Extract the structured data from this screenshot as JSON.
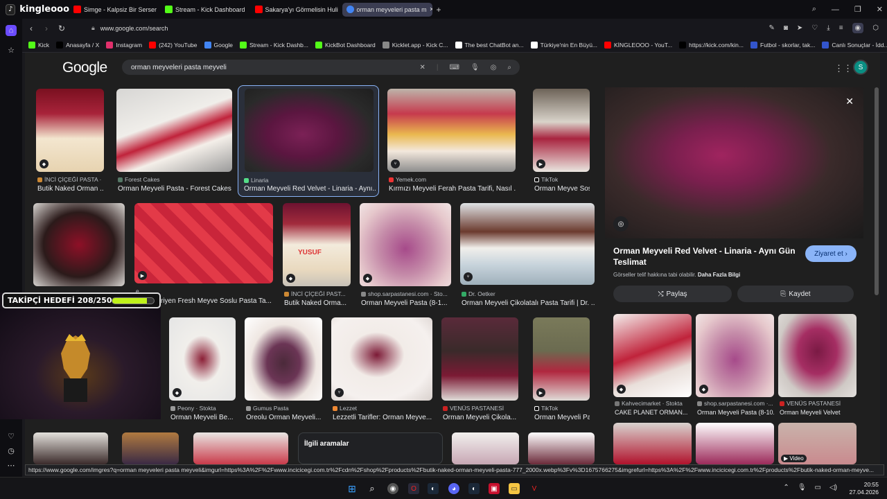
{
  "browser": {
    "brand": "kingleooo",
    "tabs": [
      {
        "label": "Simge - Kalpsiz Bir Serser",
        "color": "#ff0000"
      },
      {
        "label": "Stream - Kick Dashboard",
        "color": "#53fc18"
      },
      {
        "label": "Sakarya'yı Görmelisin Huli",
        "color": "#ff0000"
      },
      {
        "label": "orman meyveleri pasta m",
        "color": "#4285f4",
        "active": true
      }
    ],
    "url": "www.google.com/search",
    "bookmarks": [
      {
        "label": "Kick",
        "color": "#53fc18"
      },
      {
        "label": "Anasayfa / X",
        "color": "#000000"
      },
      {
        "label": "Instagram",
        "color": "#e1306c"
      },
      {
        "label": "(242) YouTube",
        "color": "#ff0000"
      },
      {
        "label": "Google",
        "color": "#4285f4"
      },
      {
        "label": "Stream - Kick Dashb...",
        "color": "#53fc18"
      },
      {
        "label": "KickBot Dashboard",
        "color": "#53fc18"
      },
      {
        "label": "Kicklet.app - Kick C...",
        "color": "#888888"
      },
      {
        "label": "The best ChatBot an...",
        "color": "#ffffff"
      },
      {
        "label": "Türkiye'nin En Büyü...",
        "color": "#ffffff"
      },
      {
        "label": "KİNGLEOOO - YouT...",
        "color": "#ff0000"
      },
      {
        "label": "https://kick.com/kin...",
        "color": "#000000"
      },
      {
        "label": "Futbol - skorlar, tak...",
        "color": "#3355cc"
      },
      {
        "label": "Canlı Sonuçlar - İdd...",
        "color": "#3355cc"
      }
    ],
    "status_url": "https://www.google.com/imgres?q=orman meyveleri pasta meyveli&imgurl=https%3A%2F%2Fwww.incicicegi.com.tr%2Fcdn%2Fshop%2Fproducts%2Fbutik-naked-orman-meyveli-pasta-777_2000x.webp%3Fv%3D1675766275&imgrefurl=https%3A%2F%2Fwww.incicicegi.com.tr%2Fproducts%2Fbutik-naked-orman-meyve..."
  },
  "google": {
    "logo": "Google",
    "query": "orman meyveleri pasta meyveli",
    "avatar_letter": "S"
  },
  "results": {
    "row1": [
      {
        "source": "İNCİ ÇİÇEĞİ PASTA ·",
        "title": "Butik Naked Orman ..."
      },
      {
        "source": "Forest Cakes",
        "title": "Orman Meyveli Pasta - Forest Cakes"
      },
      {
        "source": "Linaria",
        "title": "Orman Meyveli Red Velvet - Linaria - Aynı..."
      },
      {
        "source": "Yemek.com",
        "title": "Kırmızı Meyveli Ferah Pasta Tarifi, Nasıl ..."
      },
      {
        "source": "TikTok",
        "title": "Orman Meyve Sosl..."
      }
    ],
    "row2": [
      {
        "source": "İNCİ ÇİÇEĞİ PAST...",
        "title": "Butik Naked Orma..."
      },
      {
        "source": "shop.sarpastanesi.com · Sto...",
        "title": "Orman Meyveli Pasta (8-1..."
      },
      {
        "source": "Dr. Oetker",
        "title": "Orman Meyveli Çikolatalı Pasta Tarifi | Dr. ..."
      }
    ],
    "row2_partial_title": "riyen Fresh Meyve Soslu Pasta Ta...",
    "row2_partial_source": "e",
    "row3": [
      {
        "source": "Peony · Stokta",
        "title": "Orman Meyveli Be..."
      },
      {
        "source": "Gumus Pasta",
        "title": "Oreolu Orman Meyveli..."
      },
      {
        "source": "Lezzet",
        "title": "Lezzetli Tarifler: Orman Meyve..."
      },
      {
        "source": "VENÜS PASTANESİ",
        "title": "Orman Meyveli Çikola..."
      },
      {
        "source": "TikTok",
        "title": "Orman Meyveli Pa..."
      }
    ],
    "related_label": "İlgili aramalar"
  },
  "panel": {
    "title": "Orman Meyveli Red Velvet - Linaria - Aynı Gün Teslimat",
    "visit": "Ziyaret et",
    "note": "Görseller telif hakkına tabi olabilir.",
    "note_link": "Daha Fazla Bilgi",
    "share": "Paylaş",
    "save": "Kaydet",
    "related": [
      {
        "source": "Kahvecimarket · Stokta",
        "title": "CAKE PLANET ORMAN..."
      },
      {
        "source": "shop.sarpastanesi.com ·...",
        "title": "Orman Meyveli Pasta (8-10..."
      },
      {
        "source": "VENÜS PASTANESİ",
        "title": "Orman Meyveli Velvet"
      }
    ],
    "video_label": "Video"
  },
  "stream": {
    "goal_label": "TAKİPÇİ HEDEFİ 208/250",
    "goal_progress": 0.832
  },
  "taskbar": {
    "time": "20:55",
    "date": "27.04.2026"
  }
}
